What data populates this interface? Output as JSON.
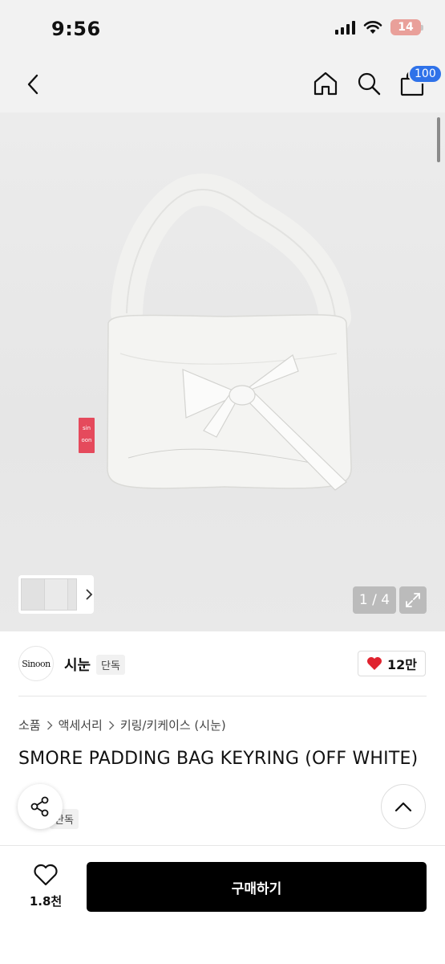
{
  "status_bar": {
    "time": "9:56",
    "battery": "14"
  },
  "nav": {
    "cart_count": "100"
  },
  "gallery": {
    "page_counter": "1 / 4"
  },
  "brand": {
    "logo_text": "Sinoon",
    "name": "시눈",
    "exclusive": "단독",
    "likes": "12만"
  },
  "breadcrumb": [
    "소품",
    "액세서리",
    "키링/키케이스 (시눈)"
  ],
  "product": {
    "title": "SMORE PADDING BAG KEYRING (OFF WHITE)",
    "exclusive": "단독",
    "tag_text": "sin oon"
  },
  "bottom_bar": {
    "wish_count": "1.8천",
    "buy_label": "구매하기"
  },
  "colors": {
    "accent_blue": "#2f72e9",
    "heart_red": "#e0232f",
    "buy_bg": "#000000"
  }
}
